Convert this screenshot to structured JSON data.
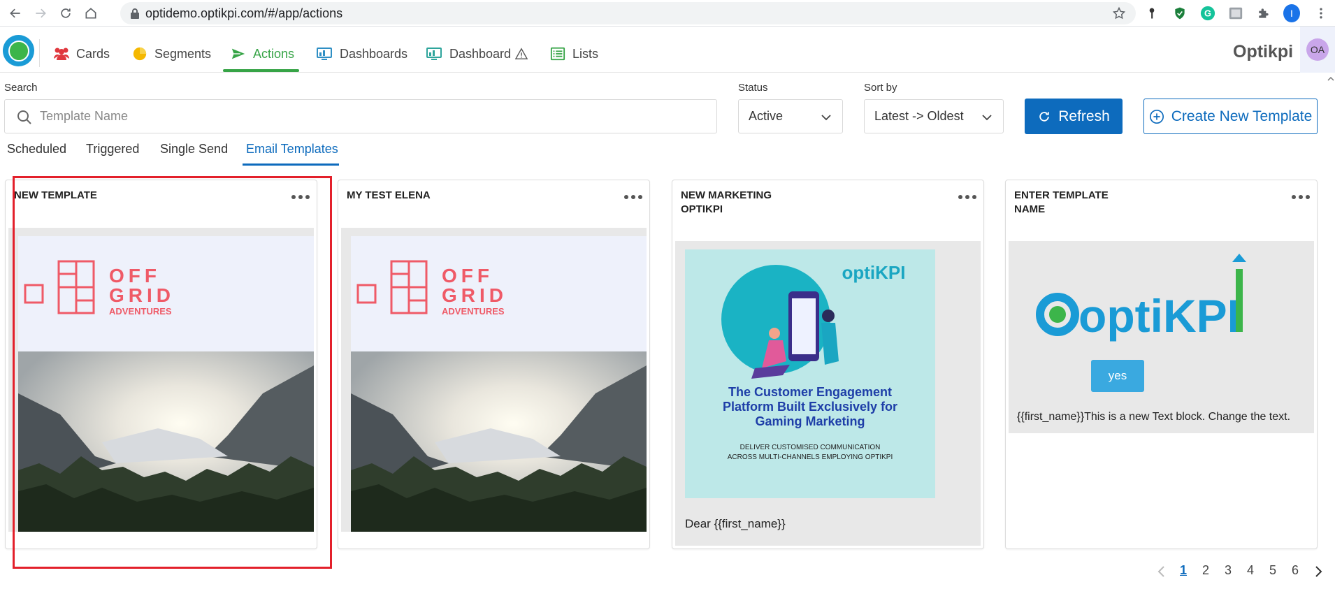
{
  "browser": {
    "url": "optidemo.optikpi.com/#/app/actions",
    "profile_initial": "I"
  },
  "nav": {
    "items": [
      {
        "label": "Cards",
        "icon": "users-icon"
      },
      {
        "label": "Segments",
        "icon": "pie-chart-icon"
      },
      {
        "label": "Actions",
        "icon": "paper-plane-icon"
      },
      {
        "label": "Dashboards",
        "icon": "dashboard-icon"
      },
      {
        "label": "Dashboard",
        "icon": "dashboard-icon"
      },
      {
        "label": "Lists",
        "icon": "list-icon"
      }
    ],
    "active": "Actions",
    "brand": "Optikpi",
    "user_initials": "OA",
    "colors": {
      "active": "#37a447",
      "primary": "#0d6bbd"
    }
  },
  "filters": {
    "search_label": "Search",
    "search_placeholder": "Template Name",
    "status_label": "Status",
    "status_value": "Active",
    "sort_label": "Sort by",
    "sort_value": "Latest -> Oldest",
    "refresh_label": "Refresh",
    "create_label": "Create New Template"
  },
  "tabs": [
    {
      "label": "Scheduled"
    },
    {
      "label": "Triggered"
    },
    {
      "label": "Single Send"
    },
    {
      "label": "Email Templates",
      "active": true
    }
  ],
  "cards": [
    {
      "title": "NEW TEMPLATE",
      "brand": {
        "line1": "OFF",
        "line2": "GRID",
        "line3": "ADVENTURES"
      },
      "selected": true
    },
    {
      "title": "MY TEST ELENA",
      "brand": {
        "line1": "OFF",
        "line2": "GRID",
        "line3": "ADVENTURES"
      }
    },
    {
      "title_line1": "NEW MARKETING",
      "title_line2": "OPTIKPI",
      "logo": "optiKPI",
      "headline1": "The Customer Engagement",
      "headline2": "Platform Built Exclusively for",
      "headline3": "Gaming Marketing",
      "sub1": "DELIVER CUSTOMISED COMMUNICATION",
      "sub2": "ACROSS MULTI-CHANNELS EMPLOYING OPTIKPI",
      "body": "Dear {{first_name}}"
    },
    {
      "title_line1": "ENTER TEMPLATE",
      "title_line2": "NAME",
      "logo": "optiKPI",
      "button_label": "yes",
      "body": "{{first_name}}This is a new Text block. Change the text."
    }
  ],
  "pagination": {
    "pages": [
      "1",
      "2",
      "3",
      "4",
      "5",
      "6"
    ],
    "current": "1"
  }
}
